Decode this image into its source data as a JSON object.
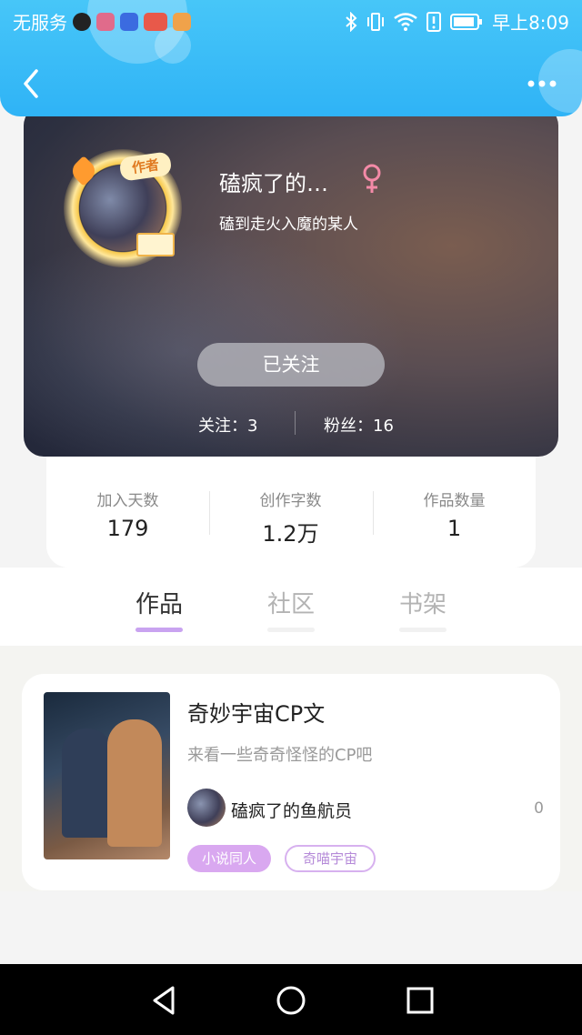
{
  "status_bar": {
    "carrier": "无服务",
    "time": "早上8:09",
    "icons": [
      "tiktok-icon",
      "app-icon",
      "baidu-icon",
      "weibo-icon",
      "video-icon",
      "bluetooth-icon",
      "vibrate-icon",
      "wifi-icon",
      "alert-icon",
      "battery-icon"
    ]
  },
  "header": {
    "back_icon": "chevron-left-icon",
    "more_icon": "more-dots-icon",
    "colors": {
      "bg_top": "#47c6f8",
      "bg_bottom": "#2fb3f6"
    }
  },
  "profile": {
    "author_badge": "作者",
    "nickname": "磕疯了的…",
    "gender_symbol": "♀",
    "bio": "磕到走火入魔的某人",
    "follow_button": "已关注",
    "following_label": "关注：",
    "following_count": "3",
    "fans_label": "粉丝：",
    "fans_count": "16"
  },
  "summary": [
    {
      "label": "加入天数",
      "value": "179"
    },
    {
      "label": "创作字数",
      "value": "1.2万"
    },
    {
      "label": "作品数量",
      "value": "1"
    }
  ],
  "tabs": [
    {
      "label": "作品",
      "active": true
    },
    {
      "label": "社区",
      "active": false
    },
    {
      "label": "书架",
      "active": false
    }
  ],
  "work": {
    "title": "奇妙宇宙CP文",
    "description": "来看一些奇奇怪怪的CP吧",
    "author": "磕疯了的鱼航员",
    "count": "0",
    "tags": [
      "小说同人",
      "奇喵宇宙"
    ]
  },
  "navbar": {
    "icons": [
      "back-triangle-icon",
      "home-circle-icon",
      "recents-square-icon"
    ]
  },
  "colors": {
    "accent_purple": "#c9a3f0",
    "tag_fill": "#d9a8f0",
    "gender_pink": "#f38aa7"
  }
}
